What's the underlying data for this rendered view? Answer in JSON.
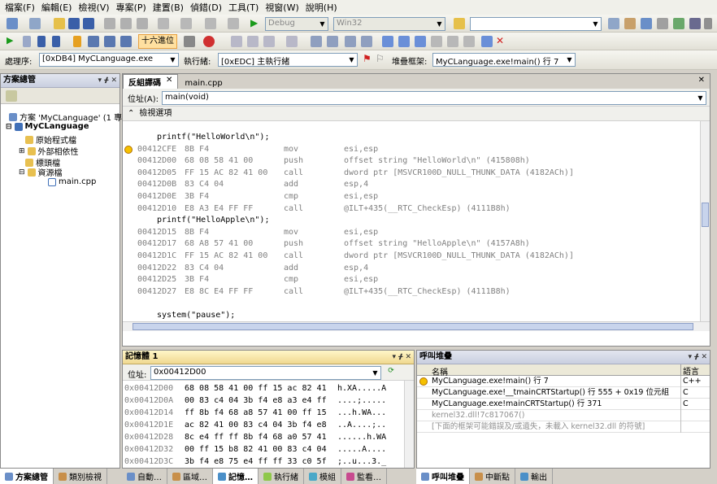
{
  "menu": [
    "檔案(F)",
    "編輯(E)",
    "檢視(V)",
    "專案(P)",
    "建置(B)",
    "偵錯(D)",
    "工具(T)",
    "視窗(W)",
    "說明(H)"
  ],
  "toolbar1": {
    "config": "Debug",
    "platform": "Win32",
    "find_value": ""
  },
  "toolbar2": {
    "hex_button": "十六進位"
  },
  "debug_location": {
    "process_label": "處理序:",
    "process": "[0xDB4] MyCLanguage.exe",
    "thread_label": "執行緒:",
    "thread": "[0xEDC] 主執行緒",
    "stack_label": "堆疊框架:",
    "stack": "MyCLanguage.exe!main() 行 7"
  },
  "solution_explorer": {
    "title": "方案總管",
    "solution": "方案 'MyCLanguage' (1 專案",
    "project": "MyCLanguage",
    "folders": [
      "原始程式檔",
      "外部相依性",
      "標頭檔",
      "資源檔"
    ],
    "file": "main.cpp"
  },
  "editor": {
    "tabs": [
      "反組譯碼",
      "main.cpp"
    ],
    "address_label": "位址(A):",
    "address": "main(void)",
    "view_options": "檢視選項",
    "lines": [
      {
        "src": "printf(\"HelloWorld\\n\");"
      },
      {
        "addr": "00412CFE",
        "bytes": "8B F4",
        "op": "mov",
        "args": "esi,esp",
        "cur": true
      },
      {
        "addr": "00412D00",
        "bytes": "68 08 58 41 00",
        "op": "push",
        "args": "offset string \"HelloWorld\\n\" (415808h)"
      },
      {
        "addr": "00412D05",
        "bytes": "FF 15 AC 82 41 00",
        "op": "call",
        "args": "dword ptr [MSVCR100D_NULL_THUNK_DATA (4182ACh)]"
      },
      {
        "addr": "00412D0B",
        "bytes": "83 C4 04",
        "op": "add",
        "args": "esp,4"
      },
      {
        "addr": "00412D0E",
        "bytes": "3B F4",
        "op": "cmp",
        "args": "esi,esp"
      },
      {
        "addr": "00412D10",
        "bytes": "E8 A3 E4 FF FF",
        "op": "call",
        "args": "@ILT+435(__RTC_CheckEsp) (4111B8h)"
      },
      {
        "src": "printf(\"HelloApple\\n\");"
      },
      {
        "addr": "00412D15",
        "bytes": "8B F4",
        "op": "mov",
        "args": "esi,esp"
      },
      {
        "addr": "00412D17",
        "bytes": "68 A8 57 41 00",
        "op": "push",
        "args": "offset string \"HelloApple\\n\" (4157A8h)"
      },
      {
        "addr": "00412D1C",
        "bytes": "FF 15 AC 82 41 00",
        "op": "call",
        "args": "dword ptr [MSVCR100D_NULL_THUNK_DATA (4182ACh)]"
      },
      {
        "addr": "00412D22",
        "bytes": "83 C4 04",
        "op": "add",
        "args": "esp,4"
      },
      {
        "addr": "00412D25",
        "bytes": "3B F4",
        "op": "cmp",
        "args": "esi,esp"
      },
      {
        "addr": "00412D27",
        "bytes": "E8 8C E4 FF FF",
        "op": "call",
        "args": "@ILT+435(__RTC_CheckEsp) (4111B8h)"
      },
      {
        "src": ""
      },
      {
        "src": "system(\"pause\");"
      }
    ]
  },
  "memory": {
    "title": "記憶體 1",
    "address_label": "位址:",
    "address": "0x00412D00",
    "rows": [
      {
        "addr": "0x00412D00",
        "hex": "68 08 58 41 00 ff 15 ac 82 41",
        "ascii": "h.XA.....A"
      },
      {
        "addr": "0x00412D0A",
        "hex": "00 83 c4 04 3b f4 e8 a3 e4 ff",
        "ascii": "....;....."
      },
      {
        "addr": "0x00412D14",
        "hex": "ff 8b f4 68 a8 57 41 00 ff 15",
        "ascii": "...h.WA..."
      },
      {
        "addr": "0x00412D1E",
        "hex": "ac 82 41 00 83 c4 04 3b f4 e8",
        "ascii": "..A....;.."
      },
      {
        "addr": "0x00412D28",
        "hex": "8c e4 ff ff 8b f4 68 a0 57 41",
        "ascii": "......h.WA"
      },
      {
        "addr": "0x00412D32",
        "hex": "00 ff 15 b8 82 41 00 83 c4 04",
        "ascii": ".....A...."
      },
      {
        "addr": "0x00412D3C",
        "hex": "3b f4 e8 75 e4 ff ff 33 c0 5f",
        "ascii": ";..u...3._"
      }
    ]
  },
  "callstack": {
    "title": "呼叫堆疊",
    "col_name": "名稱",
    "col_lang": "語言",
    "rows": [
      {
        "name": "MyCLanguage.exe!main()  行 7",
        "lang": "C++",
        "cur": true
      },
      {
        "name": "MyCLanguage.exe!__tmainCRTStartup()  行 555 + 0x19 位元組",
        "lang": "C"
      },
      {
        "name": "MyCLanguage.exe!mainCRTStartup()  行 371",
        "lang": "C"
      },
      {
        "name": "kernel32.dll!7c817067()",
        "lang": "",
        "gray": true
      },
      {
        "name": "[下面的框架可能錯誤及/或遺失，未載入 kernel32.dll 的符號]",
        "lang": "",
        "gray": true
      }
    ]
  },
  "bottom_tabs": {
    "left": [
      "方案總管",
      "類別檢視"
    ],
    "middle": [
      "自動…",
      "區域…",
      "記憶…",
      "執行緒",
      "模組",
      "監看…"
    ],
    "right": [
      "呼叫堆疊",
      "中斷點",
      "輸出"
    ]
  }
}
